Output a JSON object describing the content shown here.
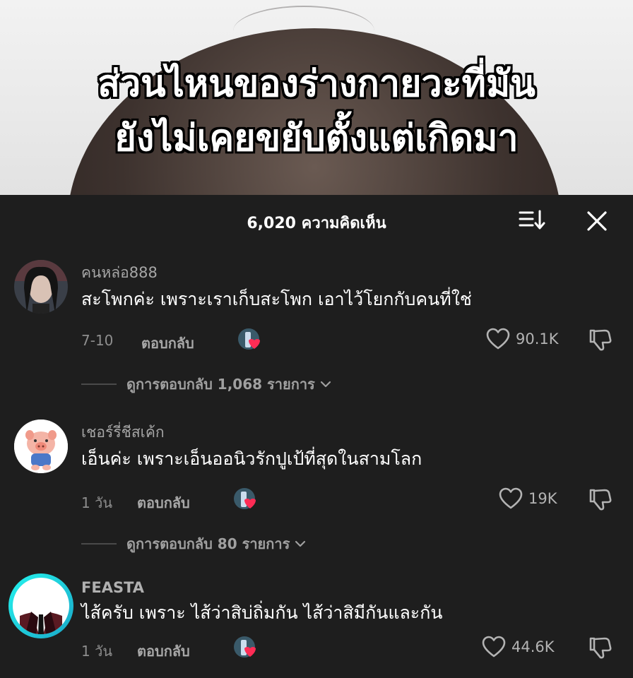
{
  "video": {
    "caption_line1": "ส่วนไหนของร่างกายวะที่มัน",
    "caption_line2": "ยังไม่เคยขยับตั้งแต่เกิดมา"
  },
  "panel": {
    "comment_count": "6,020 ความคิดเห็น",
    "icons": {
      "sort": "sort-icon",
      "close": "close-icon"
    }
  },
  "comments": [
    {
      "username": "คนหล่อ888",
      "text": "สะโพกค่ะ เพราะเราเก็บสะโพก เอาไว้โยกกับคนที่ใช่",
      "time": "7-10",
      "reply_label": "ตอบกลับ",
      "likes": "90.1K",
      "view_replies": "ดูการตอบกลับ 1,068 รายการ"
    },
    {
      "username": "เชอร์รี่ชีสเค้ก",
      "text": "เอ็นค่ะ เพราะเอ็นออนิวรักปูเป้ที่สุดในสามโลก",
      "time": "1 วัน",
      "reply_label": "ตอบกลับ",
      "likes": "19K",
      "view_replies": "ดูการตอบกลับ 80 รายการ"
    },
    {
      "username": "FEASTA",
      "text": "ไส้ครับ เพราะ ไส้ว่าสิบ่ถิ่มกัน ไส้ว่าสิมีกันและกัน",
      "time": "1 วัน",
      "reply_label": "ตอบกลับ",
      "likes": "44.6K"
    }
  ],
  "colors": {
    "panel_bg": "#1e1e1e",
    "heart_red": "#fe2c55",
    "muted": "#8e8e8e"
  }
}
